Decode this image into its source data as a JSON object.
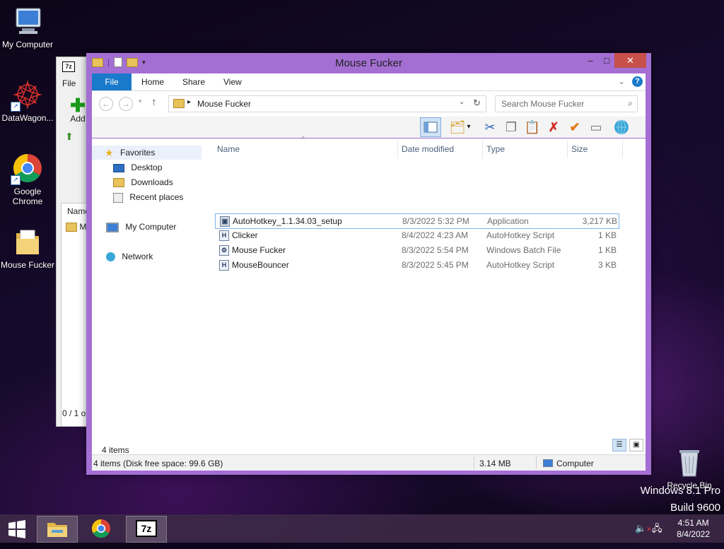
{
  "desktop": {
    "icons": [
      {
        "label": "My Computer"
      },
      {
        "label": "DataWagon..."
      },
      {
        "label": "Google Chrome"
      },
      {
        "label": "Mouse Fucker"
      },
      {
        "label": "Recycle Bin"
      }
    ],
    "watermark_line1": "Windows 8.1 Pro",
    "watermark_line2": "Build 9600"
  },
  "sevenzip": {
    "icon_text": "7z",
    "menu_file": "File",
    "add_label": "Add",
    "col_name": "Name",
    "row_label": "M",
    "status": "0 / 1 o"
  },
  "explorer": {
    "title": "Mouse Fucker",
    "tabs": [
      {
        "label": "File"
      },
      {
        "label": "Home"
      },
      {
        "label": "Share"
      },
      {
        "label": "View"
      }
    ],
    "address": "Mouse Fucker",
    "search_placeholder": "Search Mouse Fucker",
    "nav": {
      "favorites": "Favorites",
      "desktop": "Desktop",
      "downloads": "Downloads",
      "recent": "Recent places",
      "computer": "My Computer",
      "network": "Network"
    },
    "columns": {
      "name": "Name",
      "date": "Date modified",
      "type": "Type",
      "size": "Size"
    },
    "files": [
      {
        "icon": "installer-icon",
        "name": "AutoHotkey_1.1.34.03_setup",
        "date": "8/3/2022 5:32 PM",
        "type": "Application",
        "size": "3,217 KB"
      },
      {
        "icon": "ahk-script-icon",
        "name": "Clicker",
        "date": "8/4/2022 4:23 AM",
        "type": "AutoHotkey Script",
        "size": "1 KB"
      },
      {
        "icon": "batch-file-icon",
        "name": "Mouse Fucker",
        "date": "8/3/2022 5:54 PM",
        "type": "Windows Batch File",
        "size": "1 KB"
      },
      {
        "icon": "ahk-script-icon",
        "name": "MouseBouncer",
        "date": "8/3/2022 5:45 PM",
        "type": "AutoHotkey Script",
        "size": "3 KB"
      }
    ],
    "item_count": "4 items",
    "status_left": "4 items (Disk free space: 99.6 GB)",
    "status_size": "3.14 MB",
    "status_location": "Computer"
  },
  "taskbar": {
    "time": "4:51 AM",
    "date": "8/4/2022",
    "sevenzip_label": "7z"
  }
}
